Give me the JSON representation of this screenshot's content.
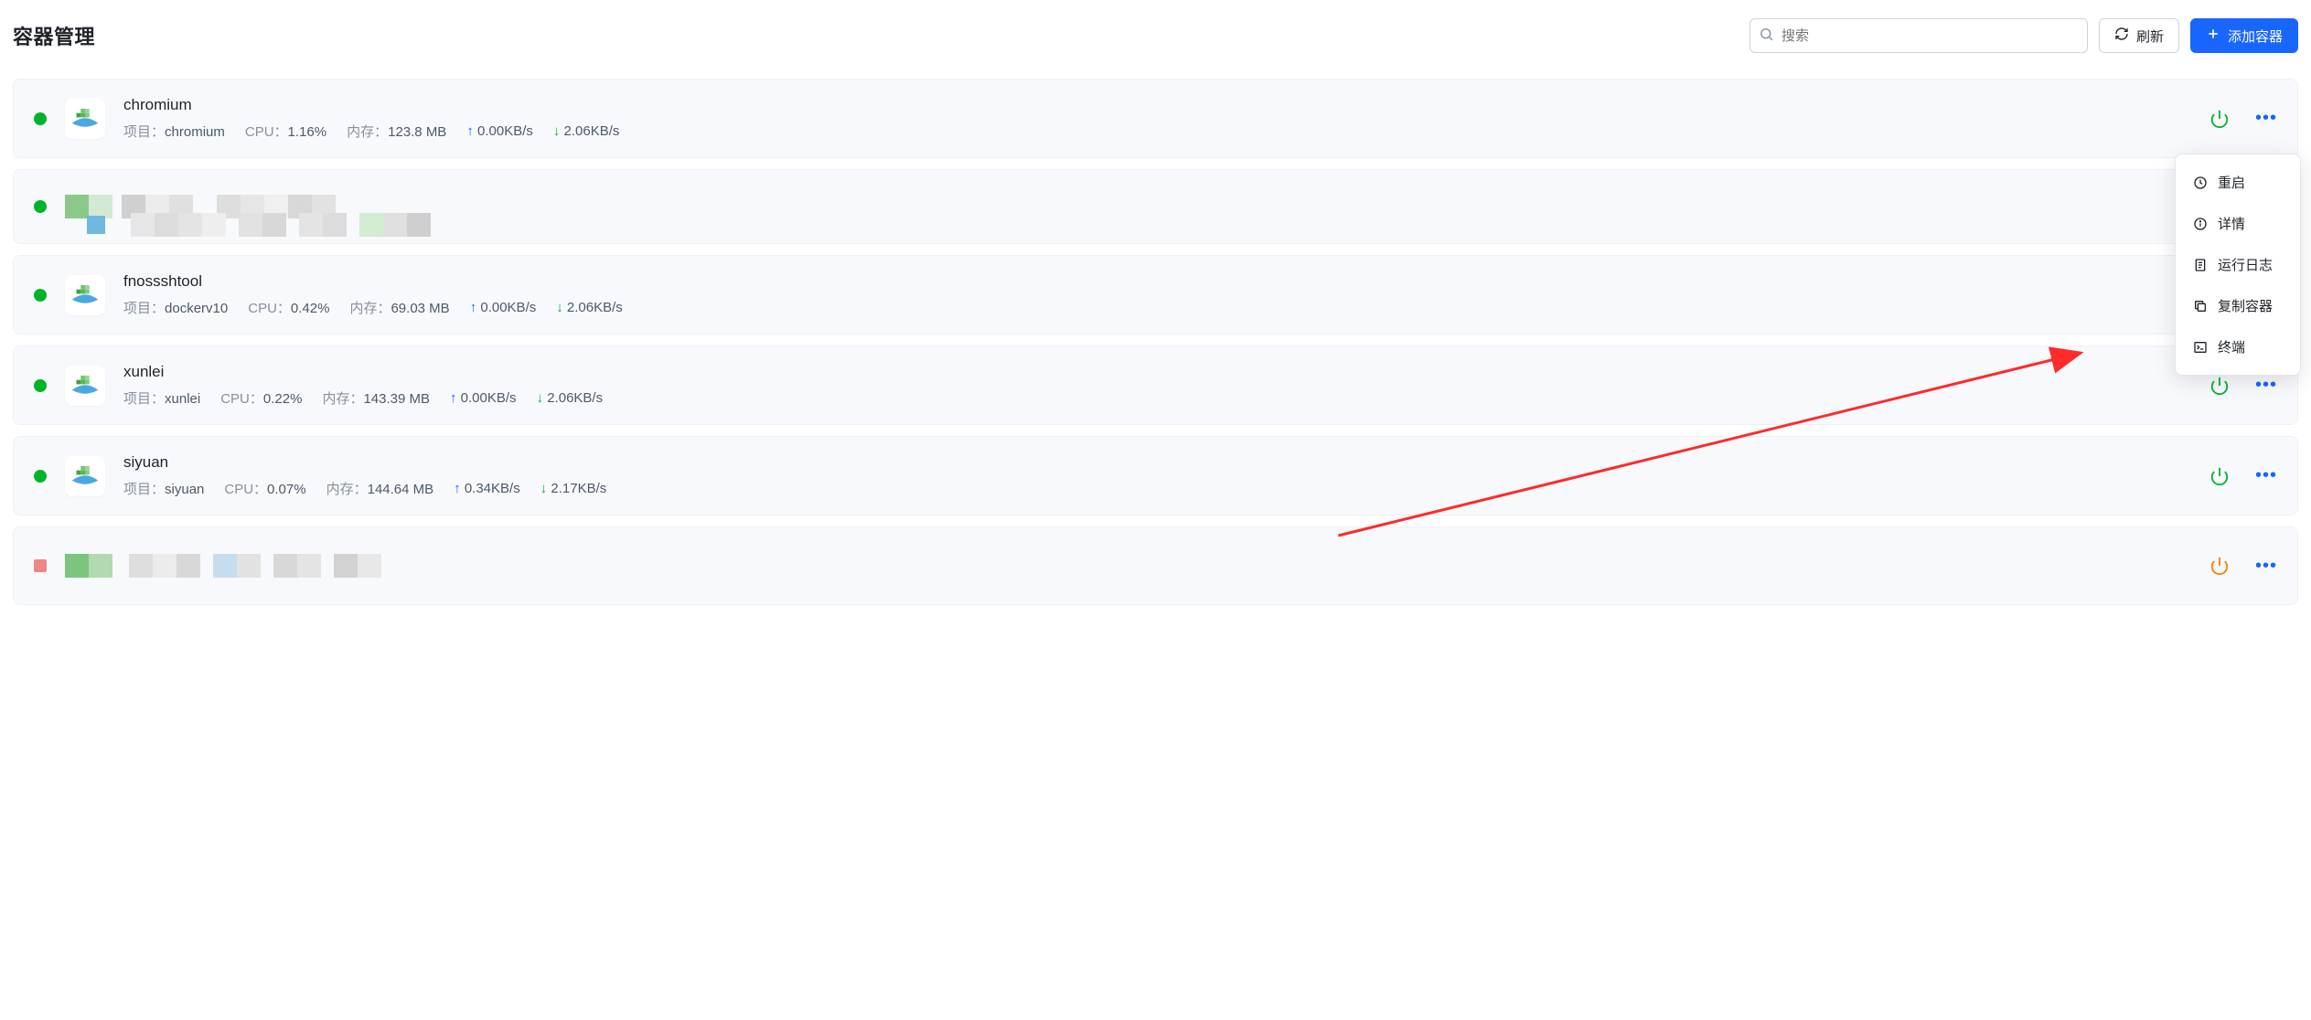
{
  "header": {
    "title": "容器管理",
    "search_placeholder": "搜索",
    "refresh_label": "刷新",
    "add_label": "添加容器"
  },
  "meta_labels": {
    "project": "项目：",
    "cpu": "CPU：",
    "mem": "内存："
  },
  "dropdown": {
    "restart": "重启",
    "details": "详情",
    "logs": "运行日志",
    "copy": "复制容器",
    "terminal": "终端"
  },
  "containers": [
    {
      "name": "chromium",
      "project": "chromium",
      "cpu": "1.16%",
      "mem": "123.8 MB",
      "up": "0.00KB/s",
      "down": "2.06KB/s",
      "status": "green",
      "power": "green",
      "redacted": false
    },
    {
      "name": "",
      "status": "green",
      "redacted": true
    },
    {
      "name": "fnossshtool",
      "project": "dockerv10",
      "cpu": "0.42%",
      "mem": "69.03 MB",
      "up": "0.00KB/s",
      "down": "2.06KB/s",
      "status": "green",
      "power": "green",
      "redacted": false
    },
    {
      "name": "xunlei",
      "project": "xunlei",
      "cpu": "0.22%",
      "mem": "143.39 MB",
      "up": "0.00KB/s",
      "down": "2.06KB/s",
      "status": "green",
      "power": "green",
      "redacted": false
    },
    {
      "name": "siyuan",
      "project": "siyuan",
      "cpu": "0.07%",
      "mem": "144.64 MB",
      "up": "0.34KB/s",
      "down": "2.17KB/s",
      "status": "green",
      "power": "green",
      "redacted": false
    },
    {
      "name": "",
      "status": "red",
      "power": "orange",
      "redacted": true
    }
  ]
}
